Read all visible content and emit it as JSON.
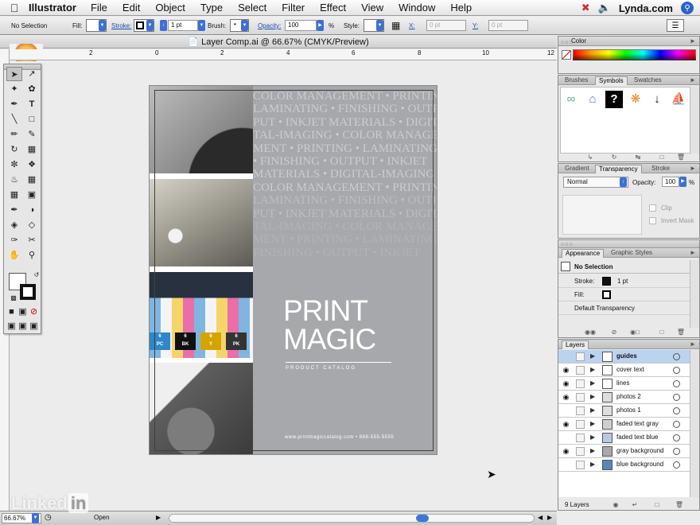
{
  "menubar": {
    "app_name": "Illustrator",
    "menus": [
      "File",
      "Edit",
      "Object",
      "Type",
      "Select",
      "Filter",
      "Effect",
      "View",
      "Window",
      "Help"
    ],
    "right_text": "Lynda.com"
  },
  "controlbar": {
    "selection": "No Selection",
    "fill_label": "Fill:",
    "stroke_label": "Stroke:",
    "stroke_weight": "1 pt",
    "brush_label": "Brush:",
    "opacity_label": "Opacity:",
    "opacity_value": "100",
    "opacity_unit": "%",
    "style_label": "Style:",
    "x_label": "X:",
    "x_value": "0 pt",
    "y_label": "Y:",
    "y_value": "0 pt"
  },
  "document": {
    "title": "Layer Comp.ai @ 66.67% (CMYK/Preview)",
    "ruler_ticks": [
      "2",
      "0",
      "2",
      "4",
      "6",
      "8",
      "10",
      "12"
    ]
  },
  "artboard": {
    "faded_lines": [
      "COLOR MANAGEMENT  •  PRINTING  •",
      "LAMINATING  •  FINISHING  •  OUTPUT",
      "PUT  •  INKJET MATERIALS  •  DIGITAL",
      "TAL-IMAGING  •  COLOR MANAGEMENT",
      "MENT  •  PRINTING  •  LAMINATING",
      "•  FINISHING  •  OUTPUT  •  INKJET",
      "MATERIALS  •  DIGITAL-IMAGING",
      "COLOR MANAGEMENT  •  PRINTING",
      "LAMINATING  •  FINISHING  •  OUTPUT",
      "PUT  •  INKJET MATERIALS  •  DIGITAL",
      "TAL-IMAGING  •  COLOR MANAGEMENT",
      "MENT  •  PRINTING  •  LAMINATING",
      "FINISHING  •  OUTPUT  •  INKJET"
    ],
    "title_line1": "PRINT",
    "title_line2": "MAGIC",
    "subtitle": "PRODUCT CATALOG",
    "footer": "www.printmagiccatalog.com  •  888-555-5555",
    "ink_labels": [
      {
        "num": "6",
        "code": "PC",
        "color": "#2d87c9"
      },
      {
        "num": "6",
        "code": "BK",
        "color": "#111111"
      },
      {
        "num": "6",
        "code": "Y",
        "color": "#d6a400"
      },
      {
        "num": "6",
        "code": "PK",
        "color": "#333333"
      }
    ]
  },
  "color_panel": {
    "title": "Color"
  },
  "symbols_panel": {
    "tabs": [
      "Brushes",
      "Symbols",
      "Swatches"
    ],
    "symbols": [
      "chain-icon",
      "house-icon",
      "question-icon",
      "leaf-icon",
      "arrow-down-icon",
      "boat-icon"
    ]
  },
  "transparency_panel": {
    "tabs": [
      "Gradient",
      "Transparency",
      "Stroke"
    ],
    "blend_mode": "Normal",
    "opacity_label": "Opacity:",
    "opacity_value": "100",
    "opacity_unit": "%",
    "clip_label": "Clip",
    "invert_label": "Invert Mask"
  },
  "appearance_panel": {
    "tabs": [
      "Appearance",
      "Graphic Styles"
    ],
    "header": "No Selection",
    "stroke_label": "Stroke:",
    "stroke_value": "1 pt",
    "fill_label": "Fill:",
    "default_text": "Default Transparency"
  },
  "layers_panel": {
    "tab": "Layers",
    "layers": [
      {
        "name": "guides",
        "visible": false,
        "active": true,
        "thumb": "#ffffff"
      },
      {
        "name": "cover text",
        "visible": true,
        "active": false,
        "thumb": "#ffffff"
      },
      {
        "name": "lines",
        "visible": true,
        "active": false,
        "thumb": "#ffffff"
      },
      {
        "name": "photos 2",
        "visible": true,
        "active": false,
        "thumb": "#dddddd"
      },
      {
        "name": "photos 1",
        "visible": false,
        "active": false,
        "thumb": "#dddddd"
      },
      {
        "name": "faded text gray",
        "visible": true,
        "active": false,
        "thumb": "#cfcfcf"
      },
      {
        "name": "faded text blue",
        "visible": false,
        "active": false,
        "thumb": "#b9c8e0"
      },
      {
        "name": "gray background",
        "visible": true,
        "active": false,
        "thumb": "#a7a8ab"
      },
      {
        "name": "blue background",
        "visible": false,
        "active": false,
        "thumb": "#5a86b8"
      }
    ],
    "count": "9 Layers"
  },
  "statusbar": {
    "zoom": "66.67%",
    "status": "Open"
  },
  "watermark": {
    "part1": "Linked",
    "part2": "in"
  }
}
